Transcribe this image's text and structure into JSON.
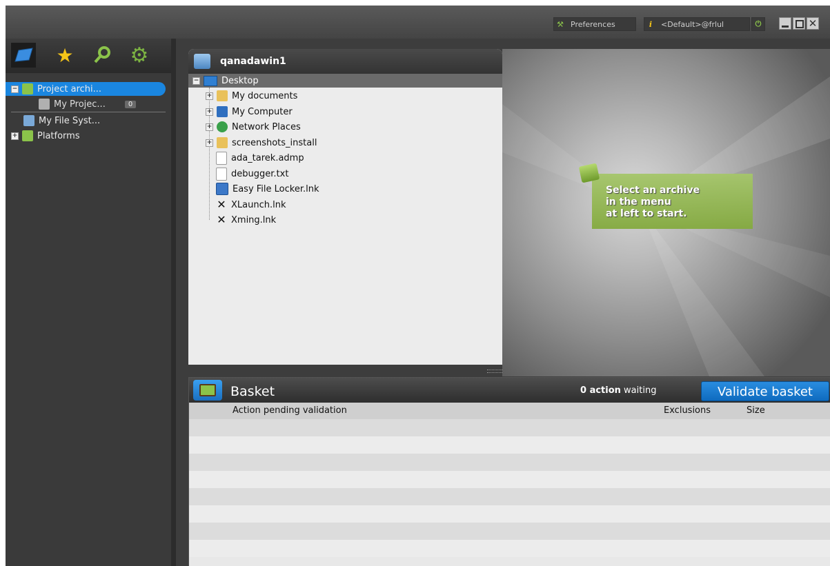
{
  "topbar": {
    "preferences_label": "Preferences",
    "user_label": "<Default>@frlul"
  },
  "sidebar": {
    "tabs": [
      {
        "name": "folder",
        "color": "#3a8de0"
      },
      {
        "name": "star",
        "color": "#f5c518"
      },
      {
        "name": "search",
        "color": "#8bc34a"
      },
      {
        "name": "gear",
        "color": "#7cb342"
      }
    ],
    "tree": [
      {
        "label": "Project archi...",
        "expander": "-"
      },
      {
        "label": "My Projec...",
        "badge": "0"
      },
      {
        "label": "My File Syst..."
      },
      {
        "label": "Platforms",
        "expander": "+"
      }
    ]
  },
  "explorer": {
    "title": "qanadawin1",
    "root": "Desktop",
    "items": [
      {
        "label": "My documents",
        "expander": "+",
        "icon": "folder-icon"
      },
      {
        "label": "My Computer",
        "expander": "+",
        "icon": "computer-icon"
      },
      {
        "label": "Network Places",
        "expander": "+",
        "icon": "network-icon"
      },
      {
        "label": "screenshots_install",
        "expander": "+",
        "icon": "folder-icon"
      },
      {
        "label": "ada_tarek.admp",
        "icon": "file-icon"
      },
      {
        "label": "debugger.txt",
        "icon": "file-icon"
      },
      {
        "label": "Easy File Locker.lnk",
        "icon": "shortcut-icon"
      },
      {
        "label": "XLaunch.lnk",
        "icon": "xlaunch-icon"
      },
      {
        "label": "Xming.lnk",
        "icon": "xming-icon"
      }
    ]
  },
  "welcome": {
    "message": "Select an archive\nin the menu\nat left to start."
  },
  "basket": {
    "title": "Basket",
    "count_bold": "0 action",
    "count_rest": "waiting",
    "validate_label": "Validate basket",
    "columns": {
      "action": "Action pending validation",
      "exclusions": "Exclusions",
      "size": "Size"
    },
    "empty_rows": 8
  },
  "colors": {
    "accent_blue": "#1a7fd6",
    "selection_blue": "#1a86e0",
    "welcome_green": "#96ba52",
    "dark_bg": "#2c2c2c"
  }
}
